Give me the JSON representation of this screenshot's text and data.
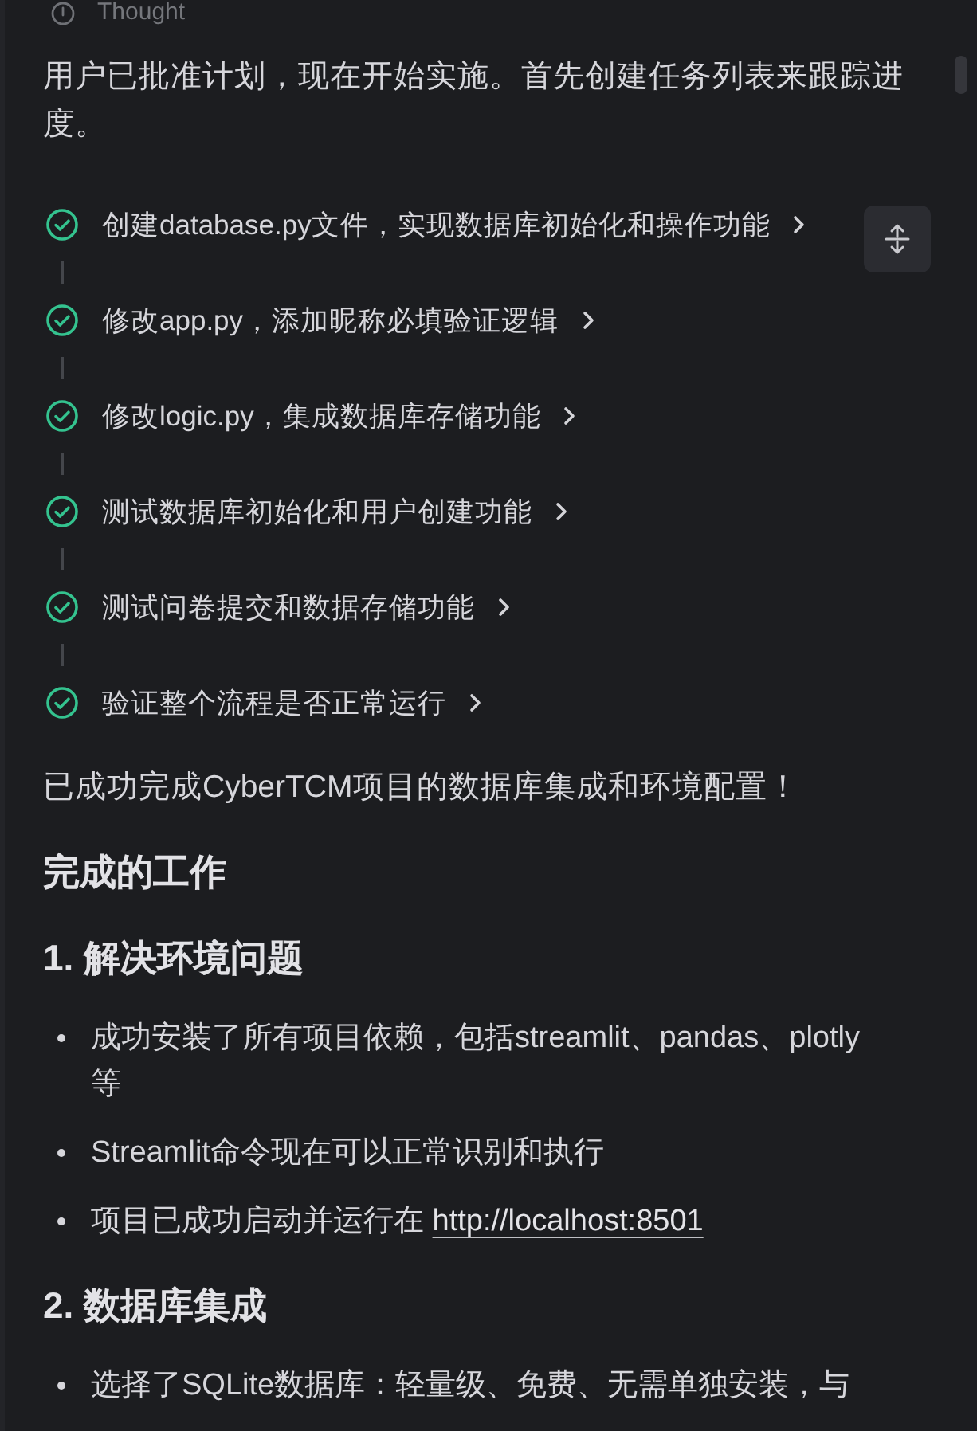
{
  "thought": {
    "label": "Thought"
  },
  "intro": "用户已批准计划，现在开始实施。首先创建任务列表来跟踪进度。",
  "todos": [
    {
      "text": "创建database.py文件，实现数据库初始化和操作功能",
      "done": true
    },
    {
      "text": "修改app.py，添加昵称必填验证逻辑",
      "done": true
    },
    {
      "text": "修改logic.py，集成数据库存储功能",
      "done": true
    },
    {
      "text": "测试数据库初始化和用户创建功能",
      "done": true
    },
    {
      "text": "测试问卷提交和数据存储功能",
      "done": true
    },
    {
      "text": "验证整个流程是否正常运行",
      "done": true
    }
  ],
  "summary": "已成功完成CyberTCM项目的数据库集成和环境配置！",
  "heading": "完成的工作",
  "sections": [
    {
      "title": "1. 解决环境问题",
      "bullets": [
        {
          "text": "成功安装了所有项目依赖，包括streamlit、pandas、plotly等"
        },
        {
          "text": "Streamlit命令现在可以正常识别和执行"
        },
        {
          "text": "项目已成功启动并运行在",
          "link": "http://localhost:8501"
        }
      ]
    },
    {
      "title": "2. 数据库集成",
      "bullets": [
        {
          "text": "选择了SQLite数据库：轻量级、免费、无需单独安装，与"
        }
      ]
    }
  ]
}
